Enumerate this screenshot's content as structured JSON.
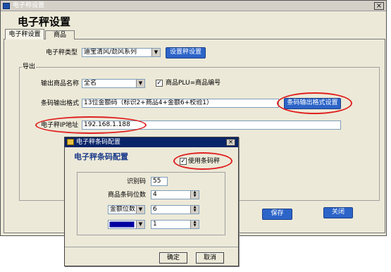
{
  "window": {
    "title": "电子称设置"
  },
  "page": {
    "title": "电子秤设置"
  },
  "tabs": [
    {
      "label": "电子秤设置"
    },
    {
      "label": "商品"
    }
  ],
  "scale": {
    "type_label": "电子秤类型",
    "type_value": "迪宝清风/劲风系列",
    "settings_button": "设置秤设置"
  },
  "export": {
    "group_label": "导出",
    "product_name_label": "输出商品名称",
    "product_name_value": "全名",
    "plu_checkbox_label": "商品PLU=商品编号",
    "plu_checked": true,
    "barcode_format_label": "条码输出格式",
    "barcode_format_value": "13位金额码（标识2+商品4+金额6+校验1）",
    "barcode_format_button": "条码输出格式设置",
    "ip_label": "电子秤IP地址",
    "ip_value": "192.168.1.188"
  },
  "actions": {
    "save": "保存",
    "close": "关闭"
  },
  "dialog": {
    "title": "电子秤条码配置",
    "heading": "电子秤条码配置",
    "use_barcode_label": "使用条码秤",
    "use_barcode_checked": true,
    "identifier_label": "识别码",
    "identifier_value": "55",
    "product_digits_label": "商品条码位数",
    "product_digits_value": "4",
    "amount_select_value": "金额位数",
    "amount_digits_value": "6",
    "extra_value": "1",
    "ok": "确定",
    "cancel": "取消"
  },
  "colors": {
    "accent_blue": "#2c64c8",
    "title_bar": "#0a246a",
    "highlight": "#e02020"
  }
}
